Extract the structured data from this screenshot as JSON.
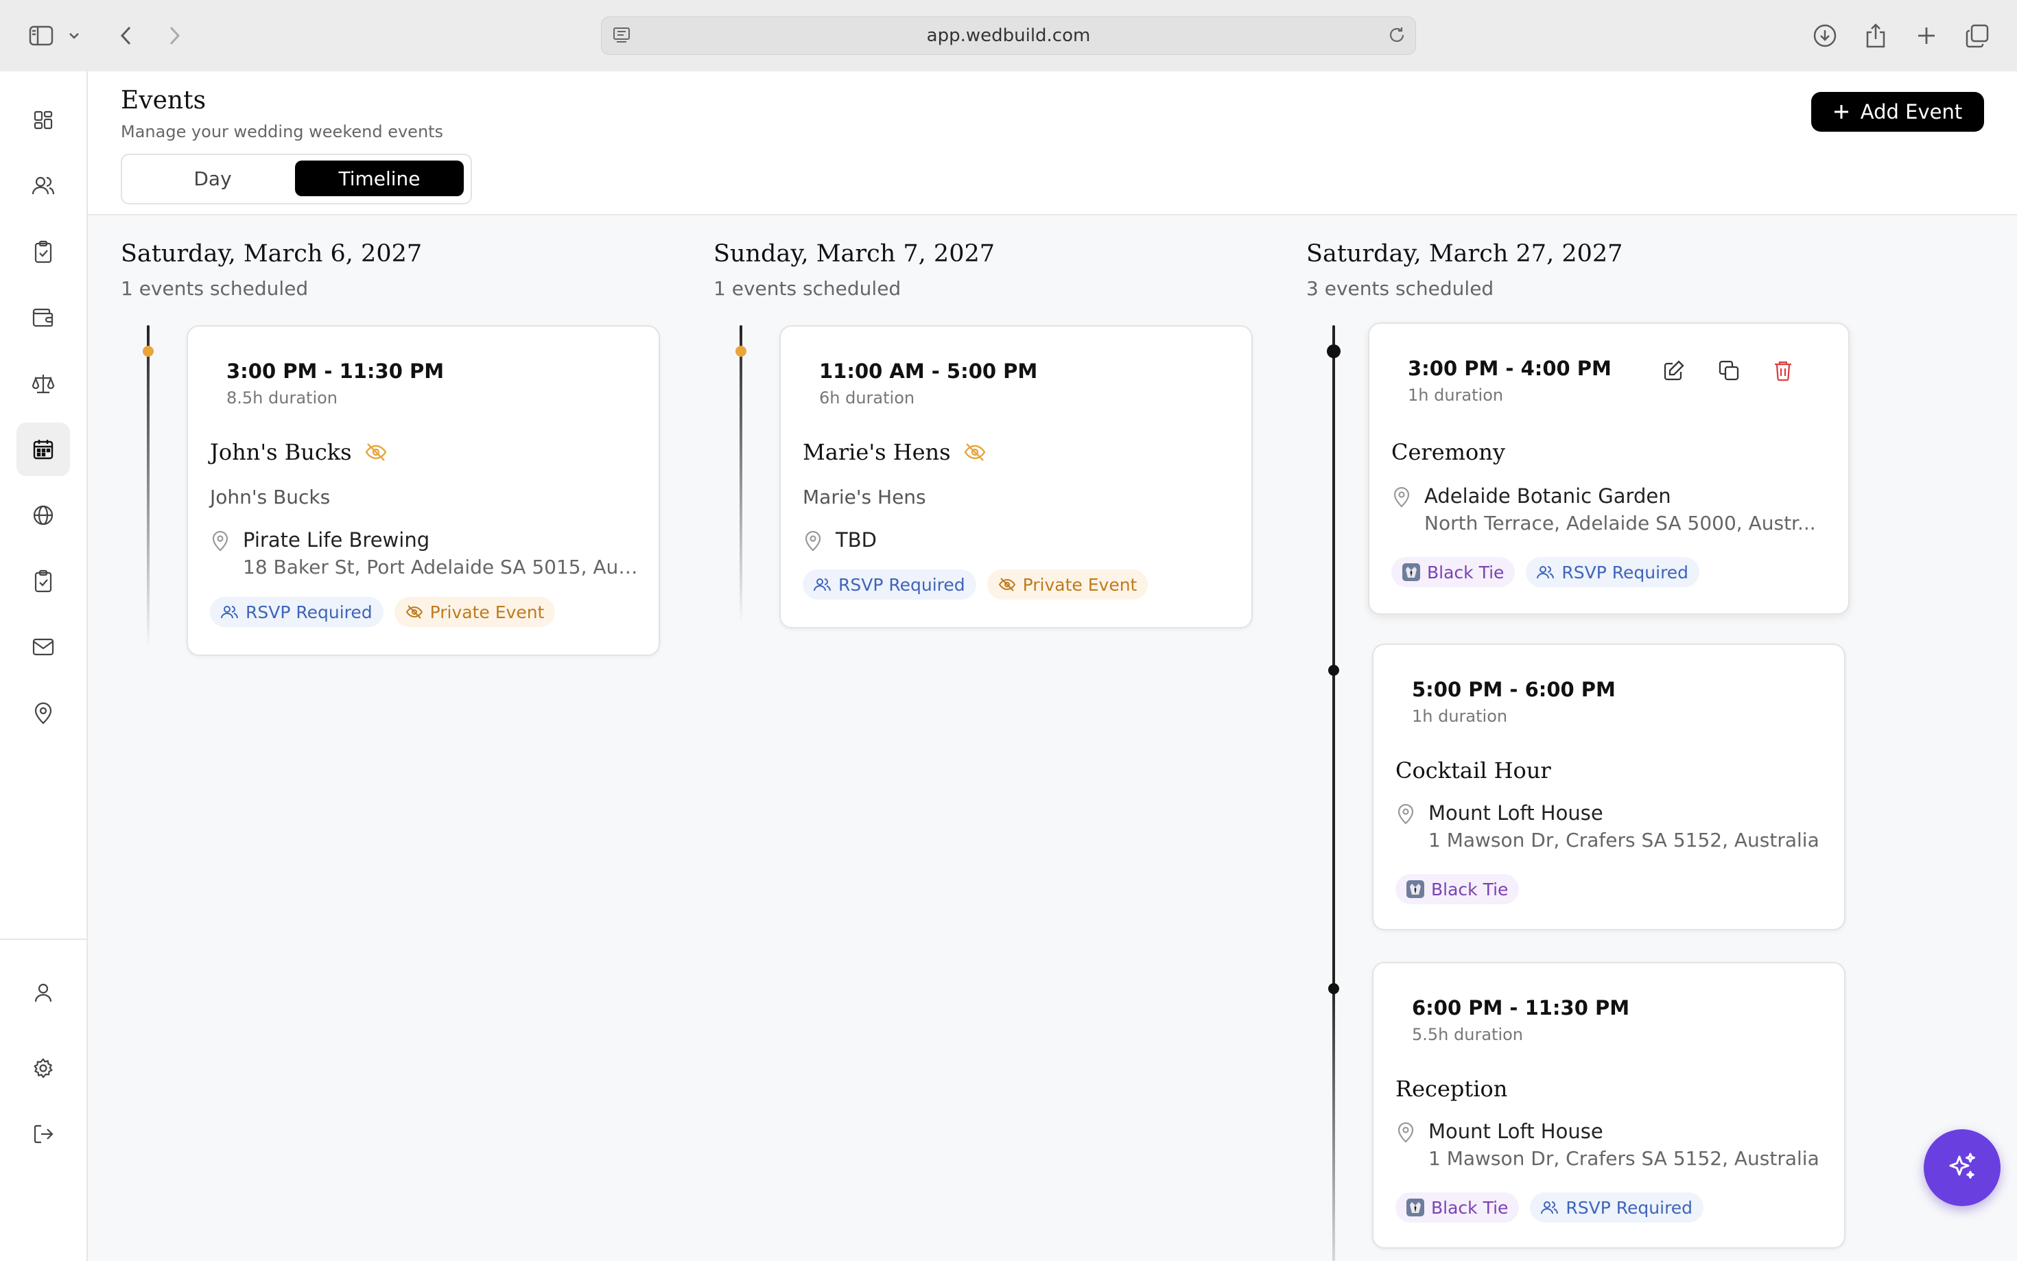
{
  "browser": {
    "url": "app.wedbuild.com"
  },
  "sidebar": {
    "items": [
      {
        "icon": "dashboard-icon"
      },
      {
        "icon": "guests-icon"
      },
      {
        "icon": "checklist-icon"
      },
      {
        "icon": "wallet-icon"
      },
      {
        "icon": "scale-icon"
      },
      {
        "icon": "calendar-icon",
        "active": true
      },
      {
        "icon": "globe-icon"
      },
      {
        "icon": "clipboard-icon"
      },
      {
        "icon": "mail-icon"
      },
      {
        "icon": "location-icon"
      }
    ],
    "bottom": [
      {
        "icon": "profile-icon"
      },
      {
        "icon": "settings-icon"
      },
      {
        "icon": "logout-icon"
      }
    ]
  },
  "header": {
    "title": "Events",
    "subtitle": "Manage your wedding weekend events",
    "view_toggle": {
      "options": [
        "Day",
        "Timeline"
      ],
      "selected": "Timeline"
    },
    "add_button": "Add Event"
  },
  "days": [
    {
      "date": "Saturday, March 6, 2027",
      "count": "1 events scheduled",
      "events": [
        {
          "time": "3:00 PM - 11:30 PM",
          "duration": "8.5h duration",
          "name": "John's Bucks",
          "private": true,
          "description": "John's Bucks",
          "venue": "Pirate Life Brewing",
          "address": "18 Baker St, Port Adelaide SA 5015, Aust...",
          "badges": [
            {
              "type": "rsvp",
              "label": "RSVP Required"
            },
            {
              "type": "priv",
              "label": "Private Event"
            }
          ]
        }
      ]
    },
    {
      "date": "Sunday, March 7, 2027",
      "count": "1 events scheduled",
      "events": [
        {
          "time": "11:00 AM - 5:00 PM",
          "duration": "6h duration",
          "name": "Marie's Hens",
          "private": true,
          "description": "Marie's Hens",
          "venue": "TBD",
          "badges": [
            {
              "type": "rsvp",
              "label": "RSVP Required"
            },
            {
              "type": "priv",
              "label": "Private Event"
            }
          ]
        }
      ]
    },
    {
      "date": "Saturday, March 27, 2027",
      "count": "3 events scheduled",
      "events": [
        {
          "time": "3:00 PM - 4:00 PM",
          "duration": "1h duration",
          "name": "Ceremony",
          "venue": "Adelaide Botanic Garden",
          "address": "North Terrace, Adelaide SA 5000, Austr...",
          "badges": [
            {
              "type": "tie",
              "label": "Black Tie"
            },
            {
              "type": "rsvp",
              "label": "RSVP Required"
            }
          ]
        },
        {
          "time": "5:00 PM - 6:00 PM",
          "duration": "1h duration",
          "name": "Cocktail Hour",
          "venue": "Mount Loft House",
          "address": "1 Mawson Dr, Crafers SA 5152, Australia",
          "badges": [
            {
              "type": "tie",
              "label": "Black Tie"
            }
          ]
        },
        {
          "time": "6:00 PM - 11:30 PM",
          "duration": "5.5h duration",
          "name": "Reception",
          "venue": "Mount Loft House",
          "address": "1 Mawson Dr, Crafers SA 5152, Australia",
          "badges": [
            {
              "type": "tie",
              "label": "Black Tie"
            },
            {
              "type": "rsvp",
              "label": "RSVP Required"
            }
          ]
        }
      ]
    }
  ],
  "colors": {
    "accent": "#000000",
    "private": "#e8a53c",
    "rsvp": "#3f64b8",
    "black_tie": "#7a42b5",
    "delete": "#d94040",
    "fab": "#6a3fe0"
  }
}
